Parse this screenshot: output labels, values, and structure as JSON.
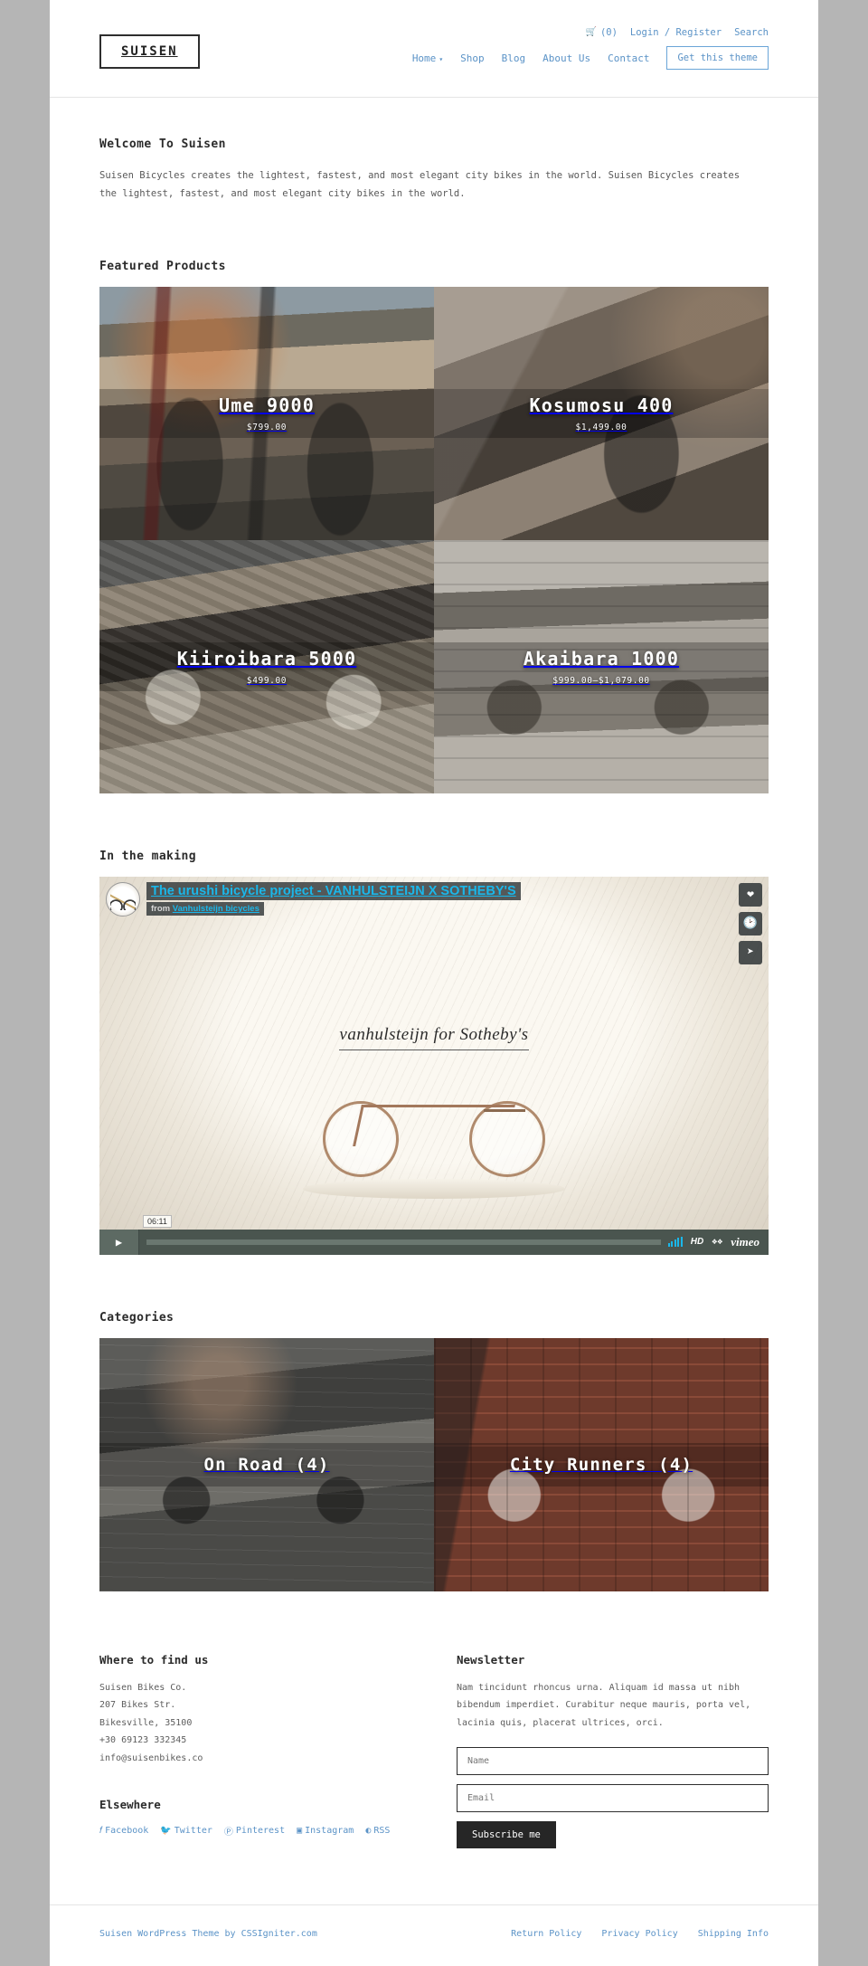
{
  "header": {
    "logo": "SUISEN",
    "topbar": {
      "cart_icon": "cart-icon",
      "cart_count": "(0)",
      "login_register": "Login / Register",
      "search": "Search"
    },
    "nav": [
      {
        "label": "Home",
        "has_dropdown": true
      },
      {
        "label": "Shop",
        "has_dropdown": false
      },
      {
        "label": "Blog",
        "has_dropdown": false
      },
      {
        "label": "About Us",
        "has_dropdown": false
      },
      {
        "label": "Contact",
        "has_dropdown": false
      }
    ],
    "cta": "Get this theme"
  },
  "intro": {
    "title": "Welcome To Suisen",
    "text": "Suisen Bicycles creates the lightest, fastest, and most elegant city bikes in the world. Suisen Bicycles creates the lightest, fastest, and most elegant city bikes in the world."
  },
  "featured": {
    "title": "Featured Products",
    "products": [
      {
        "name": "Ume 9000",
        "price": "$799.00"
      },
      {
        "name": "Kosumosu 400",
        "price": "$1,499.00"
      },
      {
        "name": "Kiiroibara 5000",
        "price": "$499.00"
      },
      {
        "name": "Akaibara 1000",
        "price": "$999.00–$1,079.00"
      }
    ]
  },
  "video": {
    "title": "In the making",
    "player": {
      "video_title": "The urushi bicycle project - VANHULSTEIJN X SOTHEBY'S",
      "from_label": "from",
      "author": "Vanhulsteijn bicycles",
      "duration": "06:11",
      "hd_badge": "HD",
      "brand": "vimeo",
      "stage_text": "vanhulsteijn for Sotheby's",
      "side_buttons": [
        "heart-icon",
        "watch-later-icon",
        "share-icon"
      ]
    }
  },
  "categories": {
    "title": "Categories",
    "items": [
      {
        "label": "On Road (4)"
      },
      {
        "label": "City Runners (4)"
      }
    ]
  },
  "footer": {
    "find_us": {
      "title": "Where to find us",
      "lines": [
        "Suisen Bikes Co.",
        "207 Bikes Str.",
        "Bikesville, 35100",
        "+30 69123 332345",
        "info@suisenbikes.co"
      ]
    },
    "elsewhere": {
      "title": "Elsewhere",
      "links": [
        {
          "label": "Facebook",
          "icon": "facebook-icon",
          "glyph": "f"
        },
        {
          "label": "Twitter",
          "icon": "twitter-icon",
          "glyph": "🐦"
        },
        {
          "label": "Pinterest",
          "icon": "pinterest-icon",
          "glyph": "Ⓟ"
        },
        {
          "label": "Instagram",
          "icon": "instagram-icon",
          "glyph": "⊡"
        },
        {
          "label": "RSS",
          "icon": "rss-icon",
          "glyph": "🛜"
        }
      ]
    },
    "newsletter": {
      "title": "Newsletter",
      "text": "Nam tincidunt rhoncus urna. Aliquam id massa ut nibh bibendum imperdiet. Curabitur neque mauris, porta vel, lacinia quis, placerat ultrices, orci.",
      "name_placeholder": "Name",
      "email_placeholder": "Email",
      "submit": "Subscribe me"
    }
  },
  "colophon": {
    "credit_prefix": "Suisen",
    "credit_mid": "WordPress Theme by",
    "credit_link": "CSSIgniter.com",
    "links": [
      "Return Policy",
      "Privacy Policy",
      "Shipping Info"
    ]
  },
  "colors": {
    "link": "#5b93c7",
    "text": "#2b2b2b",
    "dark": "#262626",
    "vimeo_blue": "#1ab7ea"
  }
}
